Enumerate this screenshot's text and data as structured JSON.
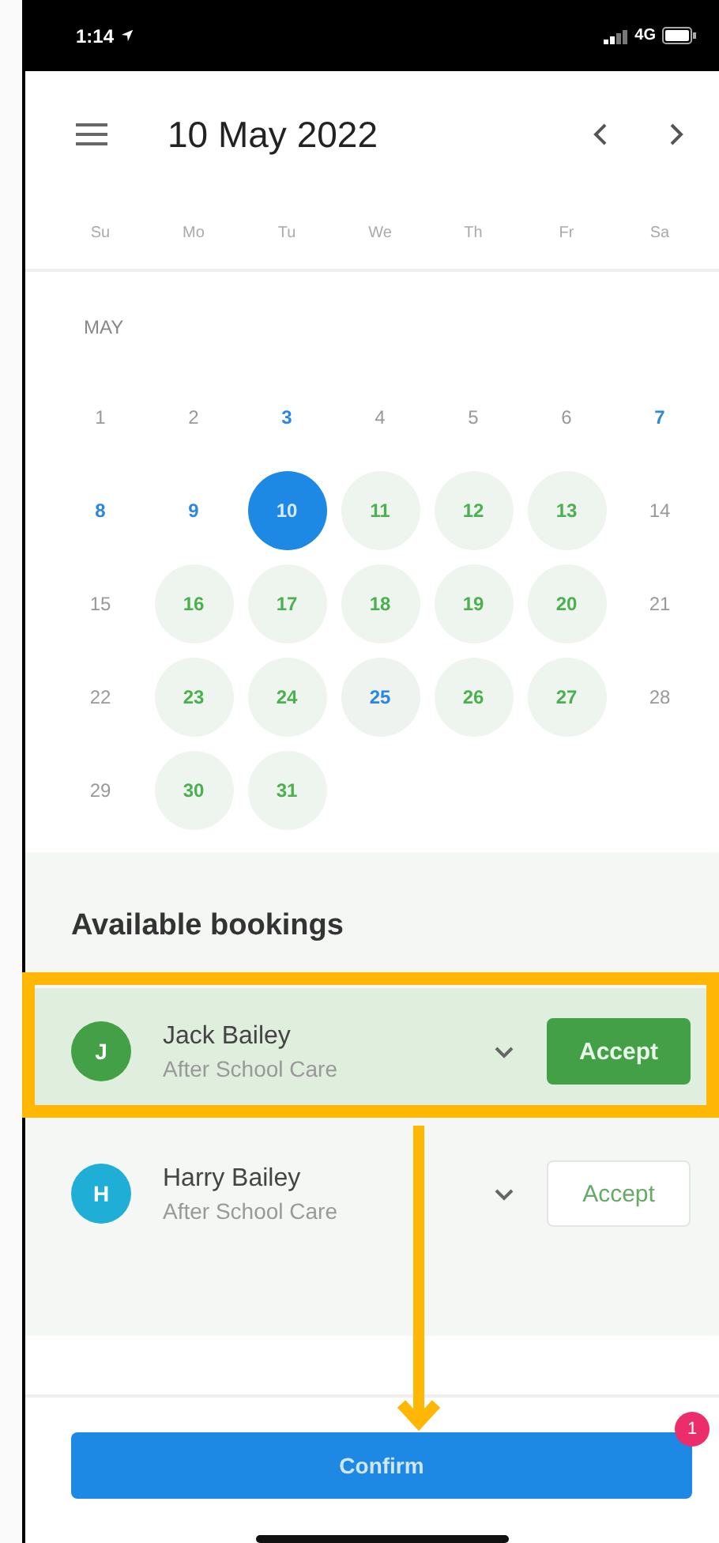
{
  "status_bar": {
    "time": "1:14",
    "network": "4G"
  },
  "header": {
    "title": "10 May 2022"
  },
  "weekdays": [
    "Su",
    "Mo",
    "Tu",
    "We",
    "Th",
    "Fr",
    "Sa"
  ],
  "calendar": {
    "month": "MAY",
    "days": [
      {
        "day": "1",
        "kind": "plain",
        "selected": false
      },
      {
        "day": "2",
        "kind": "plain",
        "selected": false
      },
      {
        "day": "3",
        "kind": "highlight",
        "selected": false
      },
      {
        "day": "4",
        "kind": "plain",
        "selected": false
      },
      {
        "day": "5",
        "kind": "plain",
        "selected": false
      },
      {
        "day": "6",
        "kind": "plain",
        "selected": false
      },
      {
        "day": "7",
        "kind": "highlight",
        "selected": false
      },
      {
        "day": "8",
        "kind": "highlight",
        "selected": false
      },
      {
        "day": "9",
        "kind": "highlight",
        "selected": false
      },
      {
        "day": "10",
        "kind": "highlight",
        "selected": true
      },
      {
        "day": "11",
        "kind": "available",
        "selected": false
      },
      {
        "day": "12",
        "kind": "available",
        "selected": false
      },
      {
        "day": "13",
        "kind": "available",
        "selected": false
      },
      {
        "day": "14",
        "kind": "plain",
        "selected": false
      },
      {
        "day": "15",
        "kind": "plain",
        "selected": false
      },
      {
        "day": "16",
        "kind": "available",
        "selected": false
      },
      {
        "day": "17",
        "kind": "available",
        "selected": false
      },
      {
        "day": "18",
        "kind": "available",
        "selected": false
      },
      {
        "day": "19",
        "kind": "available",
        "selected": false
      },
      {
        "day": "20",
        "kind": "available",
        "selected": false
      },
      {
        "day": "21",
        "kind": "plain",
        "selected": false
      },
      {
        "day": "22",
        "kind": "plain",
        "selected": false
      },
      {
        "day": "23",
        "kind": "available",
        "selected": false
      },
      {
        "day": "24",
        "kind": "available",
        "selected": false
      },
      {
        "day": "25",
        "kind": "highlight-available",
        "selected": false
      },
      {
        "day": "26",
        "kind": "available",
        "selected": false
      },
      {
        "day": "27",
        "kind": "available",
        "selected": false
      },
      {
        "day": "28",
        "kind": "plain",
        "selected": false
      },
      {
        "day": "29",
        "kind": "plain",
        "selected": false
      },
      {
        "day": "30",
        "kind": "available",
        "selected": false
      },
      {
        "day": "31",
        "kind": "available",
        "selected": false
      }
    ]
  },
  "bookings": {
    "title": "Available bookings",
    "items": [
      {
        "initial": "J",
        "name": "Jack Bailey",
        "service": "After School Care",
        "color": "#43a047",
        "selected": true,
        "action": "Accept"
      },
      {
        "initial": "H",
        "name": "Harry Bailey",
        "service": "After School Care",
        "color": "#1eaed6",
        "selected": false,
        "action": "Accept"
      }
    ]
  },
  "confirm": {
    "label": "Confirm",
    "badge": "1"
  }
}
